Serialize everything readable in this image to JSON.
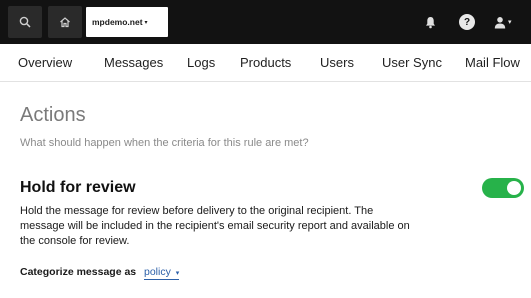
{
  "topbar": {
    "search_icon": "search-icon",
    "home_icon": "home-icon",
    "domain": "mpdemo.net",
    "domain_caret": "▾",
    "bell_icon": "bell-icon",
    "help_label": "?",
    "user_icon": "user-icon",
    "user_caret": "▾"
  },
  "nav": {
    "items": [
      {
        "label": "Overview"
      },
      {
        "label": "Messages"
      },
      {
        "label": "Logs"
      },
      {
        "label": "Products"
      },
      {
        "label": "Users"
      },
      {
        "label": "User Sync"
      },
      {
        "label": "Mail Flow"
      }
    ]
  },
  "actions": {
    "title": "Actions",
    "subtitle": "What should happen when the criteria for this rule are met?"
  },
  "hold": {
    "title": "Hold for review",
    "description": "Hold the message for review before delivery to the original recipient. The message will be included in the recipient's email security report and available on the console for review.",
    "enabled": true
  },
  "categorize": {
    "label": "Categorize message as",
    "value": "policy",
    "caret": "▾"
  },
  "colors": {
    "topbar_bg": "#121212",
    "toggle_on": "#27b24a",
    "link": "#2b5fa8"
  }
}
